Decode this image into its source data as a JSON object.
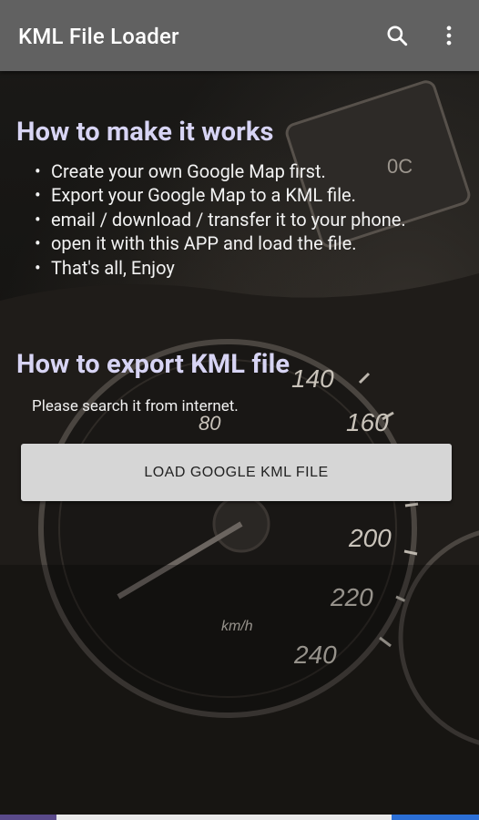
{
  "app_bar": {
    "title": "KML File Loader",
    "background": "#616161",
    "actions": [
      {
        "name": "search",
        "icon": "search-icon"
      },
      {
        "name": "more",
        "icon": "more-vert-icon"
      }
    ]
  },
  "section_how_to": {
    "heading": "How to make it works",
    "steps": [
      "Create your own Google Map first.",
      "Export your Google Map to a KML file.",
      "email / download / transfer it to your phone.",
      "open it with this APP and load the file.",
      "That's all, Enjoy"
    ]
  },
  "section_export": {
    "heading": "How to export KML file",
    "note": "Please search it from internet."
  },
  "load_button": {
    "label": "LOAD GOOGLE KML FILE"
  },
  "background_gauge_labels": [
    "140",
    "160",
    "80",
    "200",
    "220",
    "240",
    "km/h",
    "0C"
  ],
  "colors": {
    "heading": "#d7d4f4",
    "text": "#f2f2f2",
    "button_bg": "#d6d6d6"
  }
}
